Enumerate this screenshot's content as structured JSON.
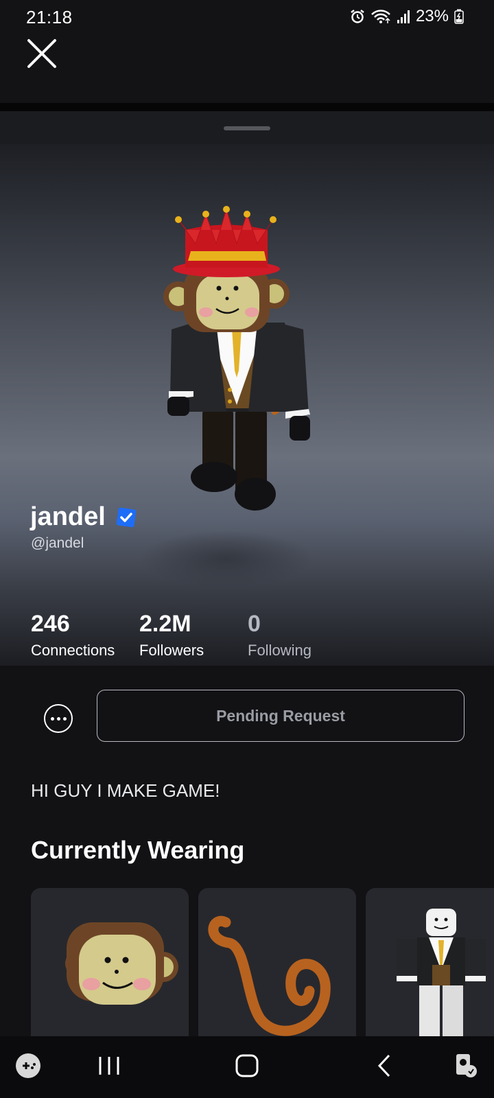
{
  "status_bar": {
    "time": "21:18",
    "battery": "23%",
    "icons": [
      "alarm-icon",
      "wifi-icon",
      "signal-icon",
      "battery-charging-icon"
    ]
  },
  "profile": {
    "display_name": "jandel",
    "username": "@jandel",
    "verified": true,
    "stats": [
      {
        "value": "246",
        "label": "Connections"
      },
      {
        "value": "2.2M",
        "label": "Followers"
      },
      {
        "value": "0",
        "label": "Following"
      }
    ],
    "action_button": "Pending Request",
    "bio": "HI GUY I MAKE GAME!"
  },
  "currently_wearing": {
    "title": "Currently Wearing",
    "items": [
      "monkey-head-item",
      "monkey-tail-item",
      "suit-outfit-item"
    ]
  },
  "colors": {
    "background": "#121215",
    "card": "#27282d",
    "verified_badge": "#1e6df6",
    "crown_red": "#d81e2a",
    "gold": "#e8b21c"
  }
}
